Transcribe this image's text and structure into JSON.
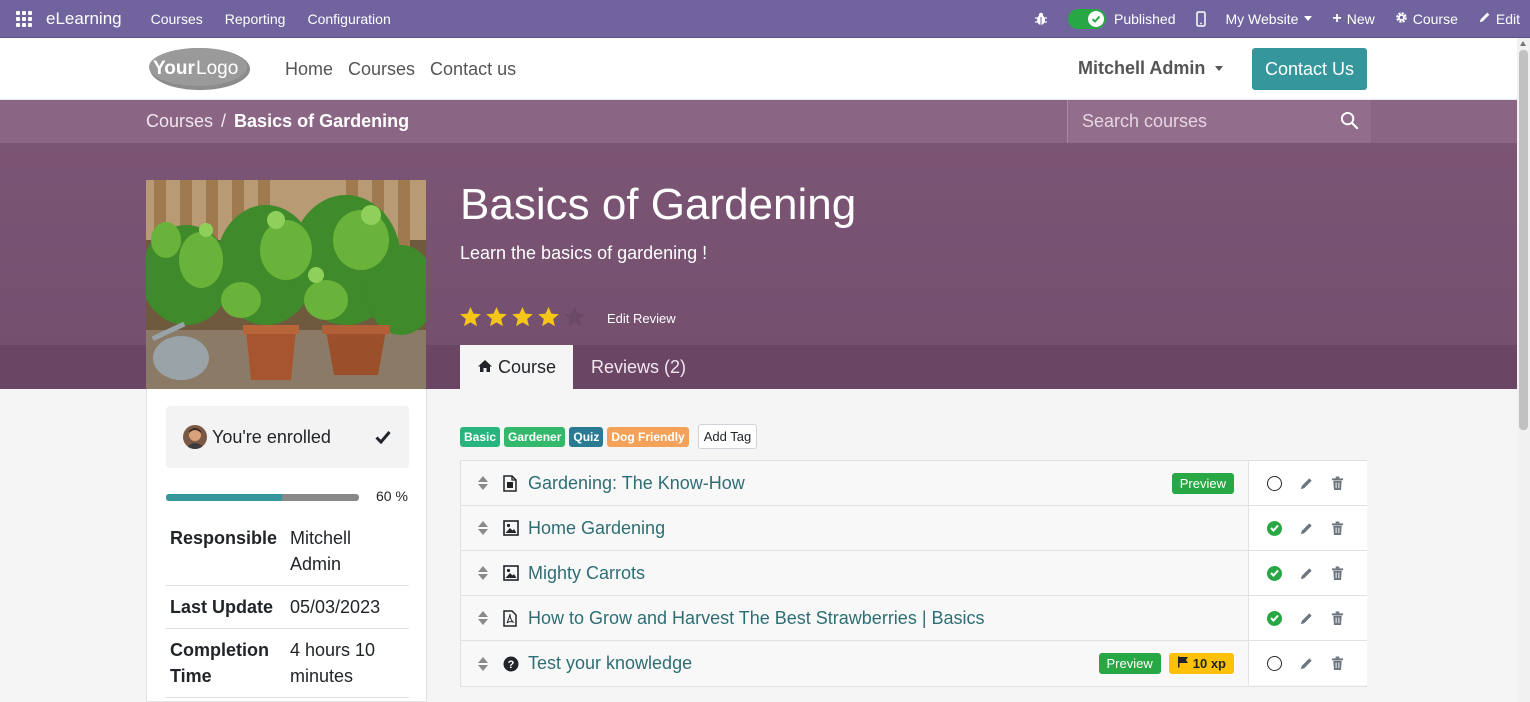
{
  "topbar": {
    "app_name": "eLearning",
    "menu": [
      "Courses",
      "Reporting",
      "Configuration"
    ],
    "published_label": "Published",
    "website_label": "My Website",
    "new_label": "New",
    "course_label": "Course",
    "edit_label": "Edit",
    "accent": "#71639e"
  },
  "header": {
    "logo_text_1": "Your",
    "logo_text_2": "Logo",
    "nav": [
      "Home",
      "Courses",
      "Contact us"
    ],
    "user": "Mitchell Admin",
    "contact_button": "Contact Us",
    "button_color": "#35979c"
  },
  "hero": {
    "breadcrumb_root": "Courses",
    "breadcrumb_sep": "/",
    "breadcrumb_current": "Basics of Gardening",
    "search_placeholder": "Search courses",
    "title": "Basics of Gardening",
    "subtitle": "Learn the basics of gardening !",
    "rating": 4,
    "rating_max": 5,
    "edit_review": "Edit Review",
    "tabs": {
      "course": "Course",
      "reviews": "Reviews (2)"
    }
  },
  "sidebar": {
    "enrolled": "You're enrolled",
    "progress": 0.6,
    "progress_label": "60 %",
    "info": [
      {
        "key": "Responsible",
        "value": "Mitchell Admin"
      },
      {
        "key": "Last Update",
        "value": "05/03/2023"
      },
      {
        "key": "Completion Time",
        "value": "4 hours 10 minutes"
      }
    ]
  },
  "tags": {
    "items": [
      {
        "label": "Basic",
        "color": "#28b47e"
      },
      {
        "label": "Gardener",
        "color": "#34b86b"
      },
      {
        "label": "Quiz",
        "color": "#2b7a94"
      },
      {
        "label": "Dog Friendly",
        "color": "#f4a259"
      }
    ],
    "add_tag": "Add Tag"
  },
  "contents": [
    {
      "title": "Gardening: The Know-How",
      "icon": "infographic-icon",
      "preview": "Preview",
      "done": false
    },
    {
      "title": "Home Gardening",
      "icon": "image-icon",
      "done": true
    },
    {
      "title": "Mighty Carrots",
      "icon": "image-icon",
      "done": true
    },
    {
      "title": "How to Grow and Harvest The Best Strawberries | Basics",
      "icon": "pdf-icon",
      "done": true
    },
    {
      "title": "Test your knowledge",
      "icon": "quiz-icon",
      "preview": "Preview",
      "xp": "10 xp",
      "done": false
    }
  ]
}
